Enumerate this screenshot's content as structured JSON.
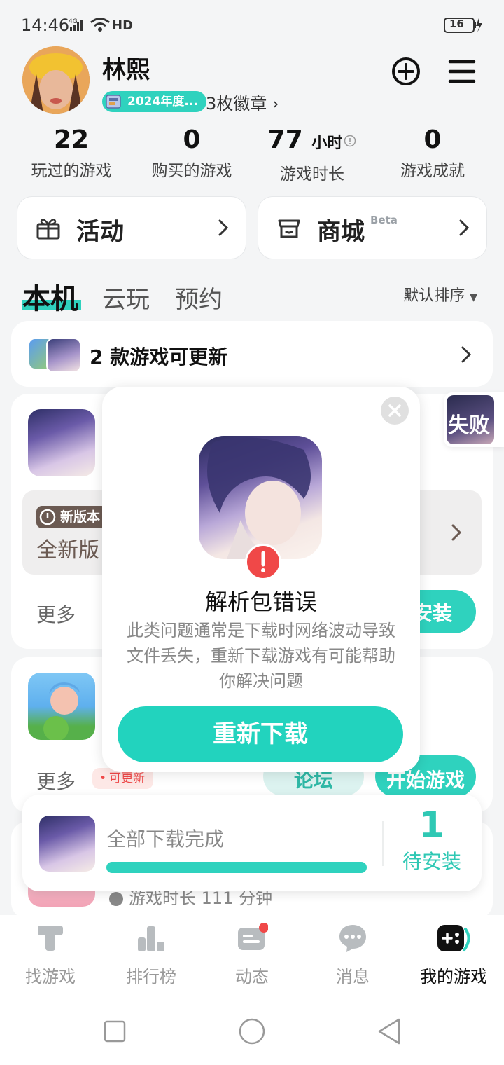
{
  "status_bar": {
    "time": "14:46",
    "network": "4G",
    "hd": "HD",
    "battery": "16"
  },
  "profile": {
    "name": "林熙",
    "badge_year": "2024年度...",
    "badge_count": "3枚徽章 ›"
  },
  "stats": [
    {
      "value": "22",
      "unit": "",
      "label": "玩过的游戏"
    },
    {
      "value": "0",
      "unit": "",
      "label": "购买的游戏"
    },
    {
      "value": "77",
      "unit": "小时",
      "label": "游戏时长"
    },
    {
      "value": "0",
      "unit": "",
      "label": "游戏成就"
    }
  ],
  "quick_cards": {
    "activity": "活动",
    "mall": "商城",
    "mall_tag": "Beta"
  },
  "tabs": {
    "local": "本机",
    "cloud": "云玩",
    "reserve": "预约",
    "sort": "默认排序"
  },
  "update_banner": {
    "text": "2 款游戏可更新"
  },
  "game1": {
    "version_tag": "新版本",
    "version_text": "全新版",
    "more": "更多",
    "install": "安装"
  },
  "game2": {
    "more": "更多",
    "update_tag": "可更新",
    "forum": "论坛",
    "start": "开始游戏"
  },
  "game3": {
    "playtime": "游戏时长 111 分钟"
  },
  "fail_badge": "失败",
  "modal": {
    "title": "解析包错误",
    "description": "此类问题通常是下载时网络波动导致文件丢失，重新下载游戏有可能帮助你解决问题",
    "button": "重新下载"
  },
  "download_bar": {
    "status": "全部下载完成",
    "progress": 1.0,
    "count": "1",
    "count_label": "待安装"
  },
  "bottom_nav": [
    {
      "label": "找游戏",
      "icon": "find-game-icon",
      "active": false
    },
    {
      "label": "排行榜",
      "icon": "ranking-icon",
      "active": false
    },
    {
      "label": "动态",
      "icon": "feed-icon",
      "active": false
    },
    {
      "label": "消息",
      "icon": "message-icon",
      "active": false
    },
    {
      "label": "我的游戏",
      "icon": "my-games-icon",
      "active": true
    }
  ],
  "colors": {
    "accent": "#2fd2be",
    "error": "#f04848",
    "background": "#f4f5f6"
  }
}
